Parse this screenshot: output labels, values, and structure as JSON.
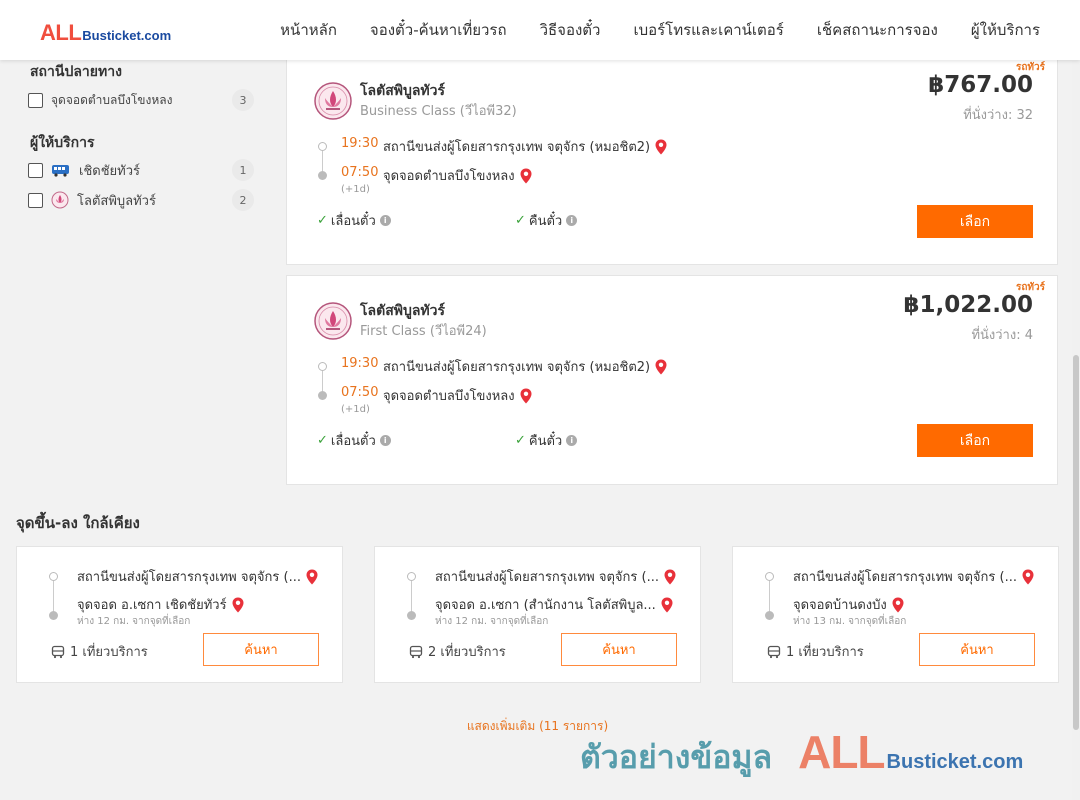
{
  "header": {
    "logo_all": "ALL",
    "logo_rest": "Busticket.com",
    "nav": [
      "หน้าหลัก",
      "จองตั๋ว-ค้นหาเที่ยวรถ",
      "วิธีจองตั๋ว",
      "เบอร์โทรและเคาน์เตอร์",
      "เช็คสถานะการจอง",
      "ผู้ให้บริการ"
    ]
  },
  "sidebar": {
    "destination_title": "สถานีปลายทาง",
    "destination_items": [
      {
        "label": "จุดจอดตำบลบึงโขงหลง",
        "count": "3"
      }
    ],
    "operator_title": "ผู้ให้บริการ",
    "operator_items": [
      {
        "label": "เชิดชัยทัวร์",
        "count": "1",
        "icon": "bus-operator-icon"
      },
      {
        "label": "โลตัสพิบูลทัวร์",
        "count": "2",
        "icon": "lotus-icon"
      }
    ]
  },
  "trips": [
    {
      "bus_type": "รถทัวร์",
      "operator": "โลตัสพิบูลทัวร์",
      "class": "Business Class (วีไอพี32)",
      "price": "฿767.00",
      "seats": "ที่นั่งว่าง: 32",
      "depart_time": "19:30",
      "depart_stop": "สถานีขนส่งผู้โดยสารกรุงเทพ จตุจักร (หมอชิต2)",
      "arrive_time": "07:50",
      "arrive_stop": "จุดจอดตำบลบึงโขงหลง",
      "next_day": "(+1d)",
      "policy_1": "เลื่อนตั๋ว",
      "policy_2": "คืนตั๋ว",
      "select_label": "เลือก"
    },
    {
      "bus_type": "รถทัวร์",
      "operator": "โลตัสพิบูลทัวร์",
      "class": "First Class (วีไอพี24)",
      "price": "฿1,022.00",
      "seats": "ที่นั่งว่าง: 4",
      "depart_time": "19:30",
      "depart_stop": "สถานีขนส่งผู้โดยสารกรุงเทพ จตุจักร (หมอชิต2)",
      "arrive_time": "07:50",
      "arrive_stop": "จุดจอดตำบลบึงโขงหลง",
      "next_day": "(+1d)",
      "policy_1": "เลื่อนตั๋ว",
      "policy_2": "คืนตั๋ว",
      "select_label": "เลือก"
    }
  ],
  "nearby": {
    "title": "จุดขึ้น-ลง ใกล้เคียง",
    "cards": [
      {
        "from": "สถานีขนส่งผู้โดยสารกรุงเทพ จตุจักร (...",
        "to": "จุดจอด อ.เซกา เชิดชัยทัวร์",
        "distance": "ห่าง 12 กม. จากจุดที่เลือก",
        "trips": "1 เที่ยวบริการ",
        "search_label": "ค้นหา"
      },
      {
        "from": "สถานีขนส่งผู้โดยสารกรุงเทพ จตุจักร (...",
        "to": "จุดจอด อ.เซกา (สำนักงาน โลตัสพิบูล...",
        "distance": "ห่าง 12 กม. จากจุดที่เลือก",
        "trips": "2 เที่ยวบริการ",
        "search_label": "ค้นหา"
      },
      {
        "from": "สถานีขนส่งผู้โดยสารกรุงเทพ จตุจักร (...",
        "to": "จุดจอดบ้านดงบัง",
        "distance": "ห่าง 13 กม. จากจุดที่เลือก",
        "trips": "1 เที่ยวบริการ",
        "search_label": "ค้นหา"
      }
    ],
    "show_more": "แสดงเพิ่มเติม (11 รายการ)"
  },
  "watermark": {
    "sample": "ตัวอย่างข้อมูล",
    "all": "ALL",
    "rest": "Busticket.com"
  },
  "colors": {
    "accent": "#ff6a00",
    "time": "#e8731e",
    "check": "#3aa23a",
    "pin": "#e8313a",
    "logo_red": "#f04e3e",
    "logo_blue": "#1a4aa0"
  }
}
